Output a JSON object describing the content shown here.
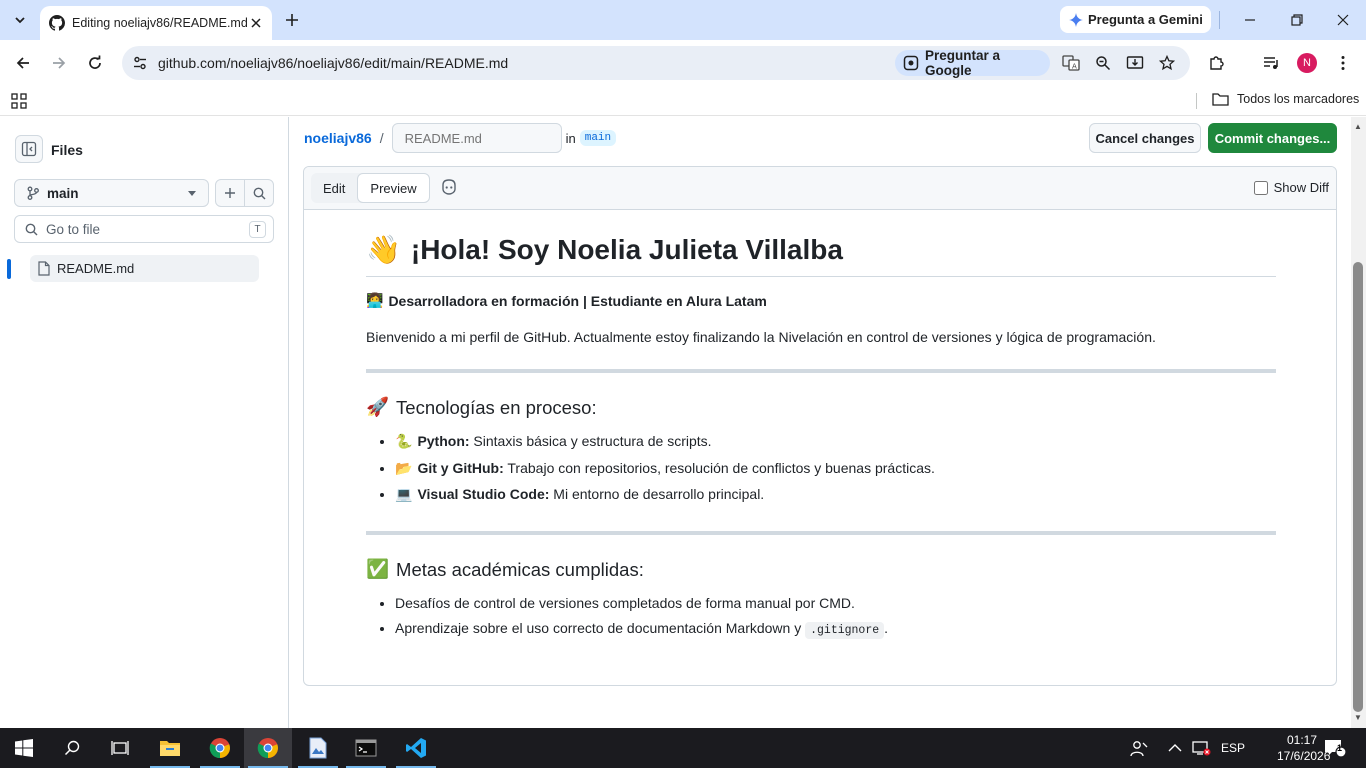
{
  "browser": {
    "tab_title": "Editing noeliajv86/README.md",
    "gemini_label": "Pregunta a Gemini",
    "url": "github.com/noeliajv86/noeliajv86/edit/main/README.md",
    "ask_google_label": "Preguntar a Google",
    "avatar_letter": "N",
    "bookmarks_all_label": "Todos los marcadores"
  },
  "sidebar": {
    "title": "Files",
    "branch": "main",
    "goto_placeholder": "Go to file",
    "goto_shortcut": "T",
    "files": [
      {
        "name": "README.md",
        "selected": true
      }
    ]
  },
  "header": {
    "owner": "noeliajv86",
    "separator": "/",
    "filename_placeholder": "README.md",
    "in_label": "in",
    "branch": "main",
    "cancel_label": "Cancel changes",
    "commit_label": "Commit changes..."
  },
  "editor": {
    "tabs": [
      {
        "label": "Edit",
        "active": false
      },
      {
        "label": "Preview",
        "active": true
      }
    ],
    "show_diff_label": "Show Diff",
    "show_diff_checked": false
  },
  "preview": {
    "h1_emoji": "👋",
    "h1_text": "¡Hola! Soy Noelia Julieta Villalba",
    "subtitle_emoji": "👩‍💻",
    "subtitle": "Desarrolladora en formación | Estudiante en Alura Latam",
    "intro": "Bienvenido a mi perfil de GitHub. Actualmente estoy finalizando la Nivelación en control de versiones y lógica de programación.",
    "section1": {
      "emoji": "🚀",
      "title": "Tecnologías en proceso:",
      "items": [
        {
          "emoji": "🐍",
          "bold": "Python:",
          "text": " Sintaxis básica y estructura de scripts."
        },
        {
          "emoji": "📂",
          "bold": "Git y GitHub:",
          "text": " Trabajo con repositorios, resolución de conflictos y buenas prácticas."
        },
        {
          "emoji": "💻",
          "bold": "Visual Studio Code:",
          "text": " Mi entorno de desarrollo principal."
        }
      ]
    },
    "section2": {
      "emoji": "✅",
      "title": "Metas académicas cumplidas:",
      "items": [
        {
          "text": "Desafíos de control de versiones completados de forma manual por CMD."
        },
        {
          "text_before": "Aprendizaje sobre el uso correcto de documentación Markdown y ",
          "code": ".gitignore",
          "text_after": "."
        }
      ]
    }
  },
  "taskbar": {
    "language": "ESP",
    "time": "01:17",
    "date": "17/6/2026",
    "notification_count": "1"
  },
  "colors": {
    "accent_blue": "#0969da",
    "commit_green": "#1f883d",
    "chrome_tab_strip": "#d3e3fd",
    "taskbar": "#1b1b1f"
  }
}
